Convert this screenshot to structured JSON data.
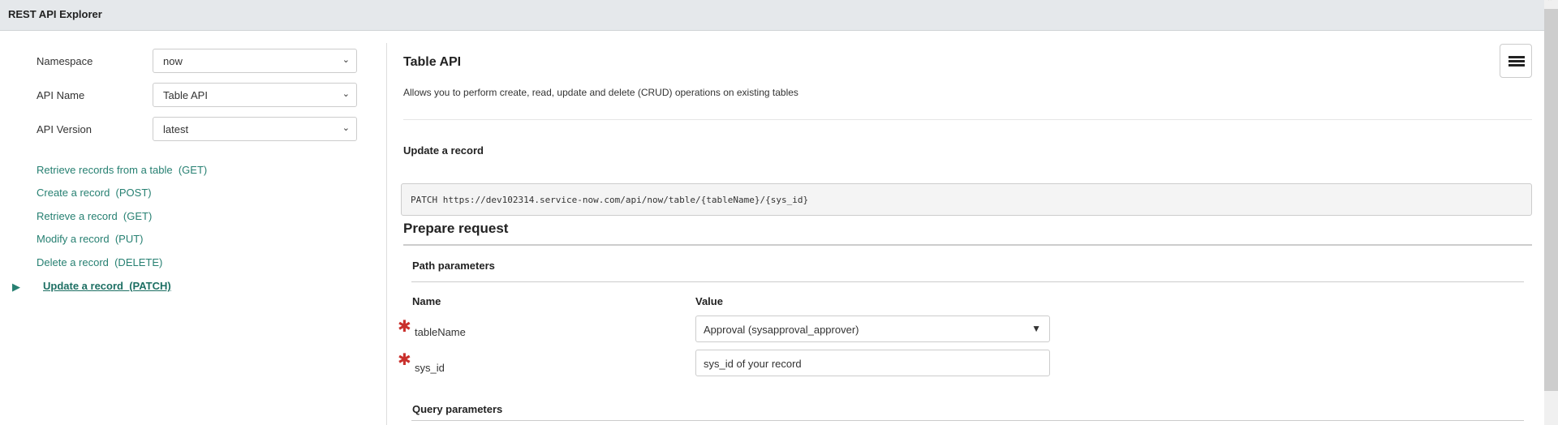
{
  "header": {
    "title": "REST API Explorer"
  },
  "sidebar": {
    "fields": [
      {
        "label": "Namespace",
        "value": "now"
      },
      {
        "label": "API Name",
        "value": "Table API"
      },
      {
        "label": "API Version",
        "value": "latest"
      }
    ],
    "methods": [
      {
        "label": "Retrieve records from a table  (GET)"
      },
      {
        "label": "Create a record  (POST)"
      },
      {
        "label": "Retrieve a record  (GET)"
      },
      {
        "label": "Modify a record  (PUT)"
      },
      {
        "label": "Delete a record  (DELETE)"
      },
      {
        "label": "Update a record  (PATCH)",
        "active": true
      }
    ]
  },
  "main": {
    "title": "Table API",
    "description": "Allows you to perform create, read, update and delete (CRUD) operations on existing tables",
    "operation": "Update a record",
    "endpoint": "PATCH https://dev102314.service-now.com/api/now/table/{tableName}/{sys_id}",
    "prepare_request": "Prepare request",
    "path_parameters": {
      "heading": "Path parameters",
      "col_name": "Name",
      "col_value": "Value",
      "rows": [
        {
          "name": "tableName",
          "value": "Approval (sysapproval_approver)"
        },
        {
          "name": "sys_id",
          "placeholder": "sys_id of your record"
        }
      ]
    },
    "query_parameters": {
      "heading": "Query parameters"
    }
  },
  "colors": {
    "accent": "#278072",
    "required": "#c9302c",
    "header_bg": "#e5e8eb"
  }
}
